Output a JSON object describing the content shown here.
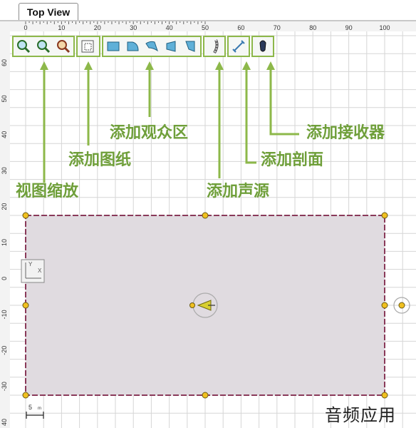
{
  "tab": {
    "title": "Top View"
  },
  "ruler_top": {
    "labels": [
      "0",
      "10",
      "20",
      "30",
      "40",
      "50",
      "60",
      "70",
      "80",
      "90",
      "100"
    ]
  },
  "ruler_left": {
    "labels": [
      "60",
      "50",
      "40",
      "30",
      "20",
      "10",
      "0",
      "-10",
      "-20",
      "-30",
      "40"
    ]
  },
  "toolbar": {
    "view_zoom": [
      "zoom-in-icon",
      "zoom-out-icon",
      "zoom-fit-icon"
    ],
    "drawing": [
      "add-drawing-icon"
    ],
    "audience": [
      "audience-rect-icon",
      "audience-arc-icon",
      "audience-curve-icon",
      "audience-trapezoid-icon",
      "audience-wedge-icon"
    ],
    "source": [
      "speaker-array-icon"
    ],
    "section": [
      "section-line-icon"
    ],
    "receiver": [
      "receiver-mic-icon"
    ]
  },
  "callouts": {
    "view_zoom": "视图缩放",
    "add_drawing": "添加图纸",
    "add_audience": "添加观众区",
    "add_source": "添加声源",
    "add_section": "添加剖面",
    "add_receiver": "添加接收器"
  },
  "axis_widget": {
    "y": "Y",
    "x": "X"
  },
  "scale_widget": {
    "value": "5",
    "unit": "m"
  },
  "colors": {
    "accent": "#8db84a",
    "region_fill": "#e0dbe0",
    "region_border": "#8a3a5a",
    "handle": "#f0c020"
  },
  "watermark": "音频应用"
}
